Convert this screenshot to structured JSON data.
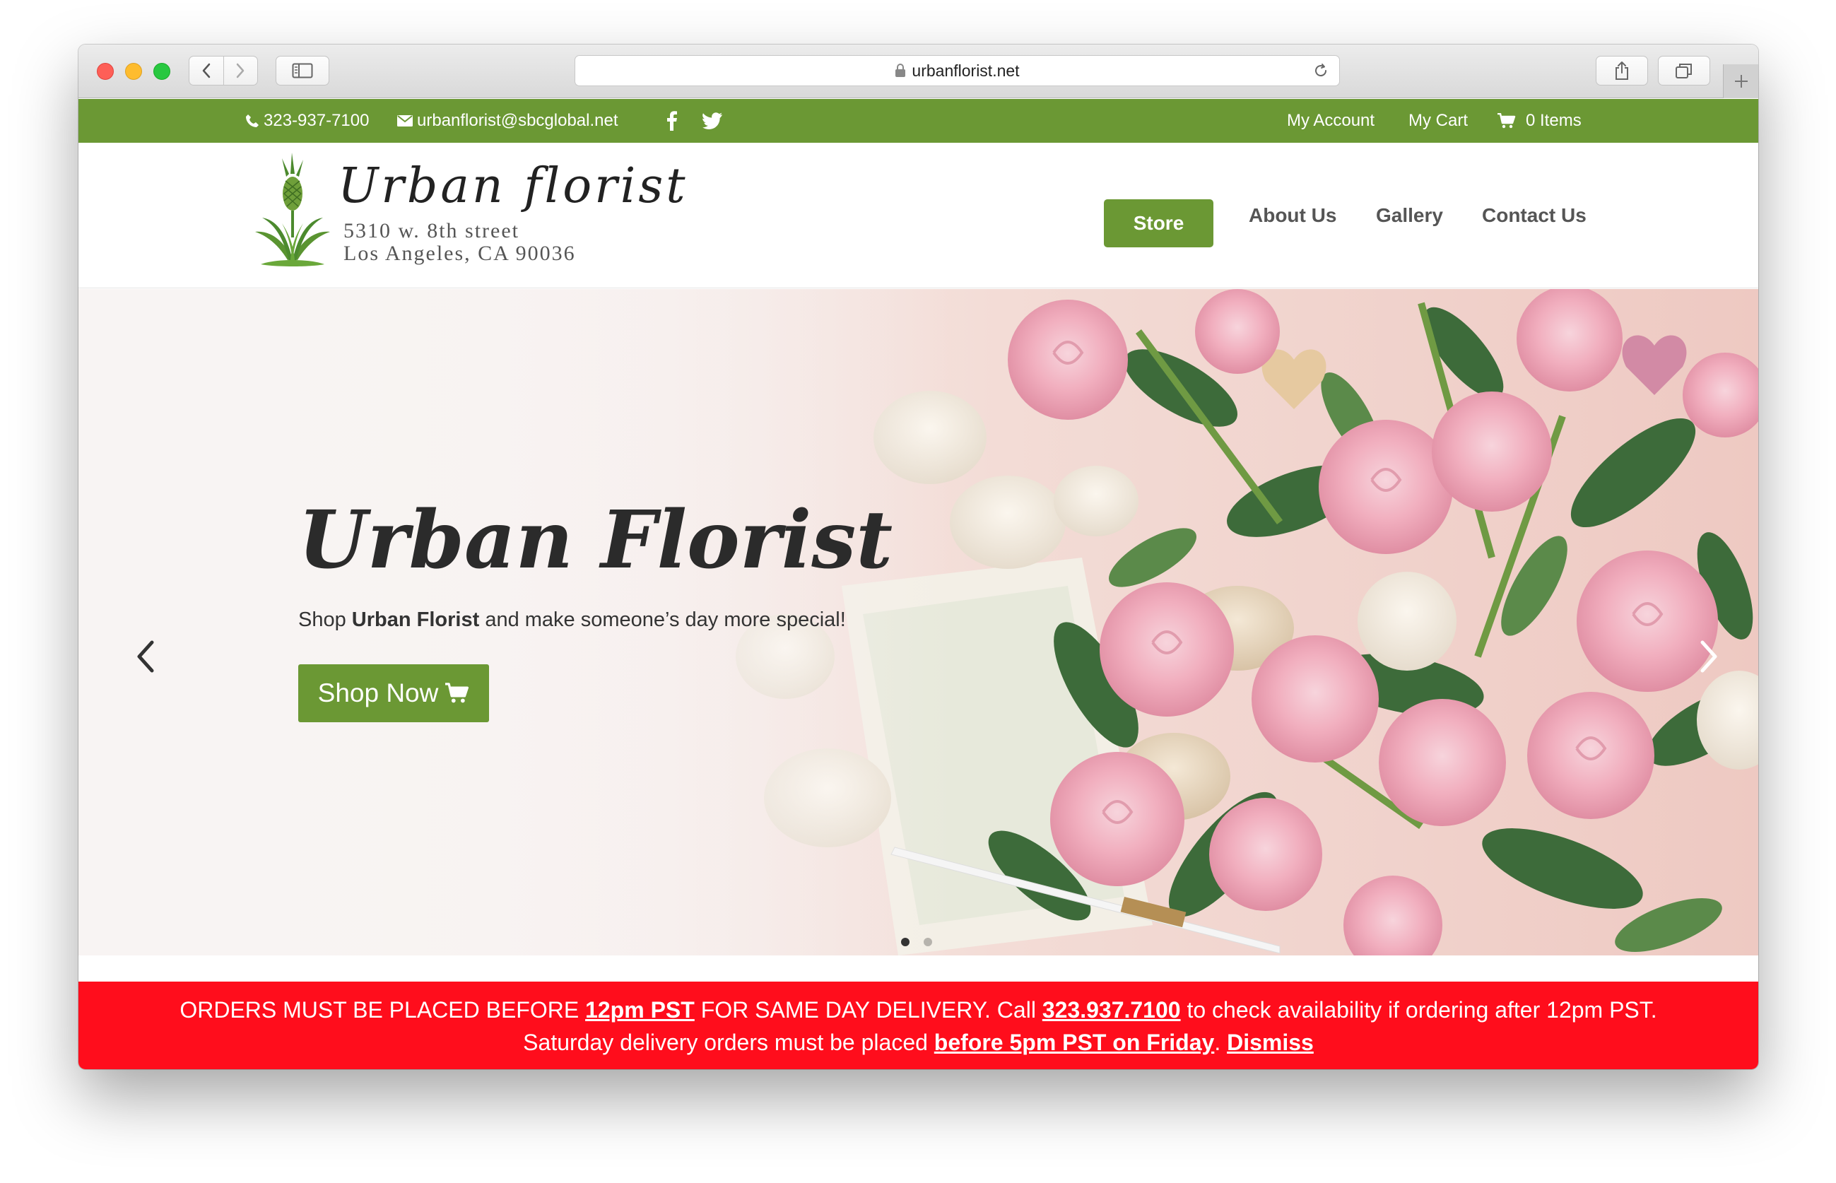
{
  "browser": {
    "url": "urbanflorist.net"
  },
  "topbar": {
    "phone": "323-937-7100",
    "email": "urbanflorist@sbcglobal.net",
    "my_account": "My Account",
    "my_cart": "My Cart",
    "cart_items": "0 Items"
  },
  "logo": {
    "title": "Urban florist",
    "address_line1": "5310 w. 8th street",
    "address_line2": "Los Angeles, CA 90036"
  },
  "nav": {
    "store": "Store",
    "about": "About Us",
    "gallery": "Gallery",
    "contact": "Contact Us"
  },
  "hero": {
    "title": "Urban Florist",
    "sub_prefix": "Shop ",
    "sub_bold": "Urban Florist",
    "sub_suffix": " and make someone’s day more special!",
    "button": "Shop Now",
    "slide_count": 2,
    "active_slide": 1
  },
  "notice": {
    "l1_a": "ORDERS MUST BE PLACED BEFORE ",
    "l1_b": "12pm PST",
    "l1_c": " FOR SAME DAY DELIVERY. Call ",
    "l1_d": "323.937.7100",
    "l1_e": " to check availability if ordering after 12pm PST.",
    "l2_a": "Saturday delivery orders must be placed ",
    "l2_b": "before 5pm PST on Friday",
    "l2_c": ". ",
    "l2_d": "Dismiss"
  },
  "colors": {
    "brand_green": "#6b9834",
    "notice_red": "#ff0d1c"
  },
  "icons": [
    "lock-icon",
    "reload-icon",
    "phone-icon",
    "envelope-icon",
    "facebook-icon",
    "twitter-icon",
    "cart-icon",
    "chevron-left-icon",
    "chevron-right-icon",
    "share-icon",
    "tabs-icon",
    "sidebar-icon"
  ]
}
